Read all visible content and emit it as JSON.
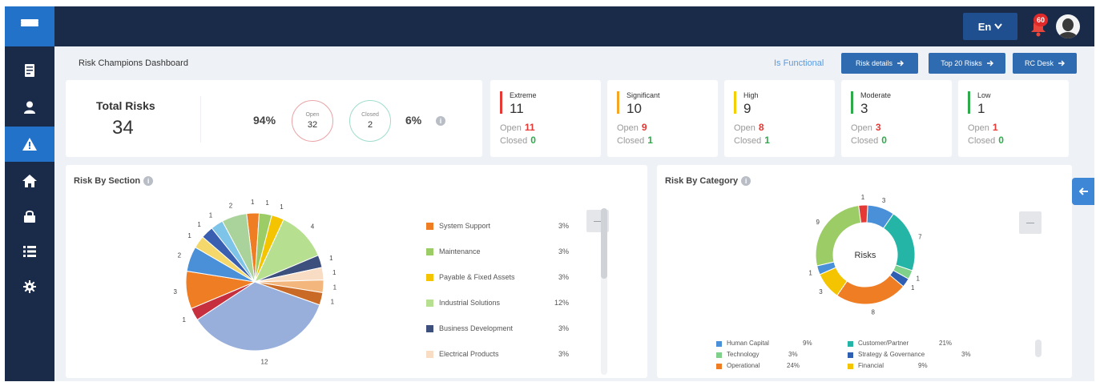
{
  "topbar": {
    "language": "En",
    "notification_count": "60"
  },
  "header": {
    "title": "Risk Champions Dashboard",
    "is_functional": "Is Functional",
    "buttons": [
      "Risk details",
      "Top 20 Risks",
      "RC Desk"
    ]
  },
  "summary": {
    "total_label": "Total Risks",
    "total_value": "34",
    "open_pct": "94%",
    "open_label": "Open",
    "open_value": "32",
    "closed_label": "Closed",
    "closed_value": "2",
    "closed_pct": "6%"
  },
  "severity": [
    {
      "label": "Extreme",
      "count": "11",
      "open": "11",
      "closed": "0",
      "color": "#e53935"
    },
    {
      "label": "Significant",
      "count": "10",
      "open": "9",
      "closed": "1",
      "color": "#f5a623"
    },
    {
      "label": "High",
      "count": "9",
      "open": "8",
      "closed": "1",
      "color": "#f5d000"
    },
    {
      "label": "Moderate",
      "count": "3",
      "open": "3",
      "closed": "0",
      "color": "#2eaa4a"
    },
    {
      "label": "Low",
      "count": "1",
      "open": "1",
      "closed": "0",
      "color": "#2eaa4a"
    }
  ],
  "severity_labels": {
    "open": "Open",
    "closed": "Closed"
  },
  "risk_by_section": {
    "title": "Risk By Section",
    "legend": [
      {
        "name": "System Support",
        "pct": "3%",
        "color": "#ef7d24"
      },
      {
        "name": "Maintenance",
        "pct": "3%",
        "color": "#9ccc65"
      },
      {
        "name": "Payable & Fixed Assets",
        "pct": "3%",
        "color": "#f5c400"
      },
      {
        "name": "Industrial Solutions",
        "pct": "12%",
        "color": "#b6df8f"
      },
      {
        "name": "Business Development",
        "pct": "3%",
        "color": "#3d4f7c"
      },
      {
        "name": "Electrical Products",
        "pct": "3%",
        "color": "#f8dcc4"
      }
    ]
  },
  "risk_by_category": {
    "title": "Risk By Category",
    "center_label": "Risks",
    "legend": [
      {
        "name": "Human Capital",
        "pct": "9%",
        "color": "#4a90d9"
      },
      {
        "name": "Customer/Partner",
        "pct": "21%",
        "color": "#25b5a6"
      },
      {
        "name": "Technology",
        "pct": "3%",
        "color": "#7ed08a"
      },
      {
        "name": "Strategy & Governance",
        "pct": "3%",
        "color": "#2f5fb3"
      },
      {
        "name": "Operational",
        "pct": "24%",
        "color": "#ef7d24"
      },
      {
        "name": "Financial",
        "pct": "9%",
        "color": "#f5c400"
      }
    ]
  },
  "chart_data": [
    {
      "type": "pie",
      "title": "Risk By Section",
      "slices": [
        {
          "value": 1,
          "color": "#ef7d24"
        },
        {
          "value": 1,
          "color": "#9ccc65"
        },
        {
          "value": 1,
          "color": "#f5c400"
        },
        {
          "value": 4,
          "color": "#b6df8f"
        },
        {
          "value": 1,
          "color": "#3d4f7c"
        },
        {
          "value": 1,
          "color": "#f8dcc4"
        },
        {
          "value": 1,
          "color": "#f3b77e"
        },
        {
          "value": 1,
          "color": "#c96b26"
        },
        {
          "value": 12,
          "color": "#98afdc"
        },
        {
          "value": 1,
          "color": "#c6303e"
        },
        {
          "value": 3,
          "color": "#ef7d24"
        },
        {
          "value": 2,
          "color": "#4a90d9"
        },
        {
          "value": 1,
          "color": "#f5d86b"
        },
        {
          "value": 1,
          "color": "#3a5fb0"
        },
        {
          "value": 1,
          "color": "#7ec3e8"
        },
        {
          "value": 2,
          "color": "#a9d39a"
        }
      ]
    },
    {
      "type": "pie",
      "title": "Risk By Category",
      "slices": [
        {
          "value": 3,
          "color": "#4a90d9"
        },
        {
          "value": 7,
          "color": "#25b5a6"
        },
        {
          "value": 1,
          "color": "#7ed08a"
        },
        {
          "value": 1,
          "color": "#2f5fb3"
        },
        {
          "value": 8,
          "color": "#ef7d24"
        },
        {
          "value": 3,
          "color": "#f5c400"
        },
        {
          "value": 1,
          "color": "#4a90d9"
        },
        {
          "value": 9,
          "color": "#9ccc65"
        },
        {
          "value": 1,
          "color": "#e53935"
        }
      ]
    }
  ]
}
